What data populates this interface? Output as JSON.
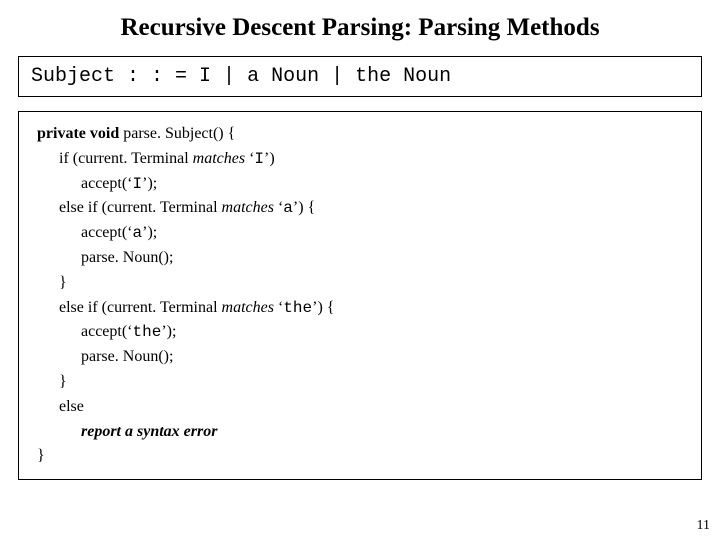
{
  "title": "Recursive Descent Parsing: Parsing Methods",
  "grammar": {
    "lhs": "Subject",
    "op": " : : = ",
    "alt1": "I",
    "sep": " | ",
    "alt2a": "a",
    "alt2b": " Noun",
    "alt3a": "the",
    "alt3b": " Noun"
  },
  "code": {
    "l1a": "private void ",
    "l1b": "parse. Subject() {",
    "l2a": "if (",
    "l2b": "current. Terminal ",
    "l2c": "matches",
    "l2d": " ‘",
    "l2e": "I",
    "l2f": "’)",
    "l3a": "accept(‘",
    "l3b": "I",
    "l3c": "’);",
    "l4a": "else if (",
    "l4b": "current. Terminal ",
    "l4c": "matches",
    "l4d": " ‘",
    "l4e": "a",
    "l4f": "’) {",
    "l5a": "accept(‘",
    "l5b": "a",
    "l5c": "’);",
    "l6": "parse. Noun();",
    "l7": "}",
    "l8a": "else if (",
    "l8b": "current. Terminal ",
    "l8c": "matches",
    "l8d": " ‘",
    "l8e": "the",
    "l8f": "’) {",
    "l9a": "accept(‘",
    "l9b": "the",
    "l9c": "’);",
    "l10": "parse. Noun();",
    "l11": "}",
    "l12": "else",
    "l13": "report a syntax error",
    "l14": "}"
  },
  "pagenum": "11"
}
